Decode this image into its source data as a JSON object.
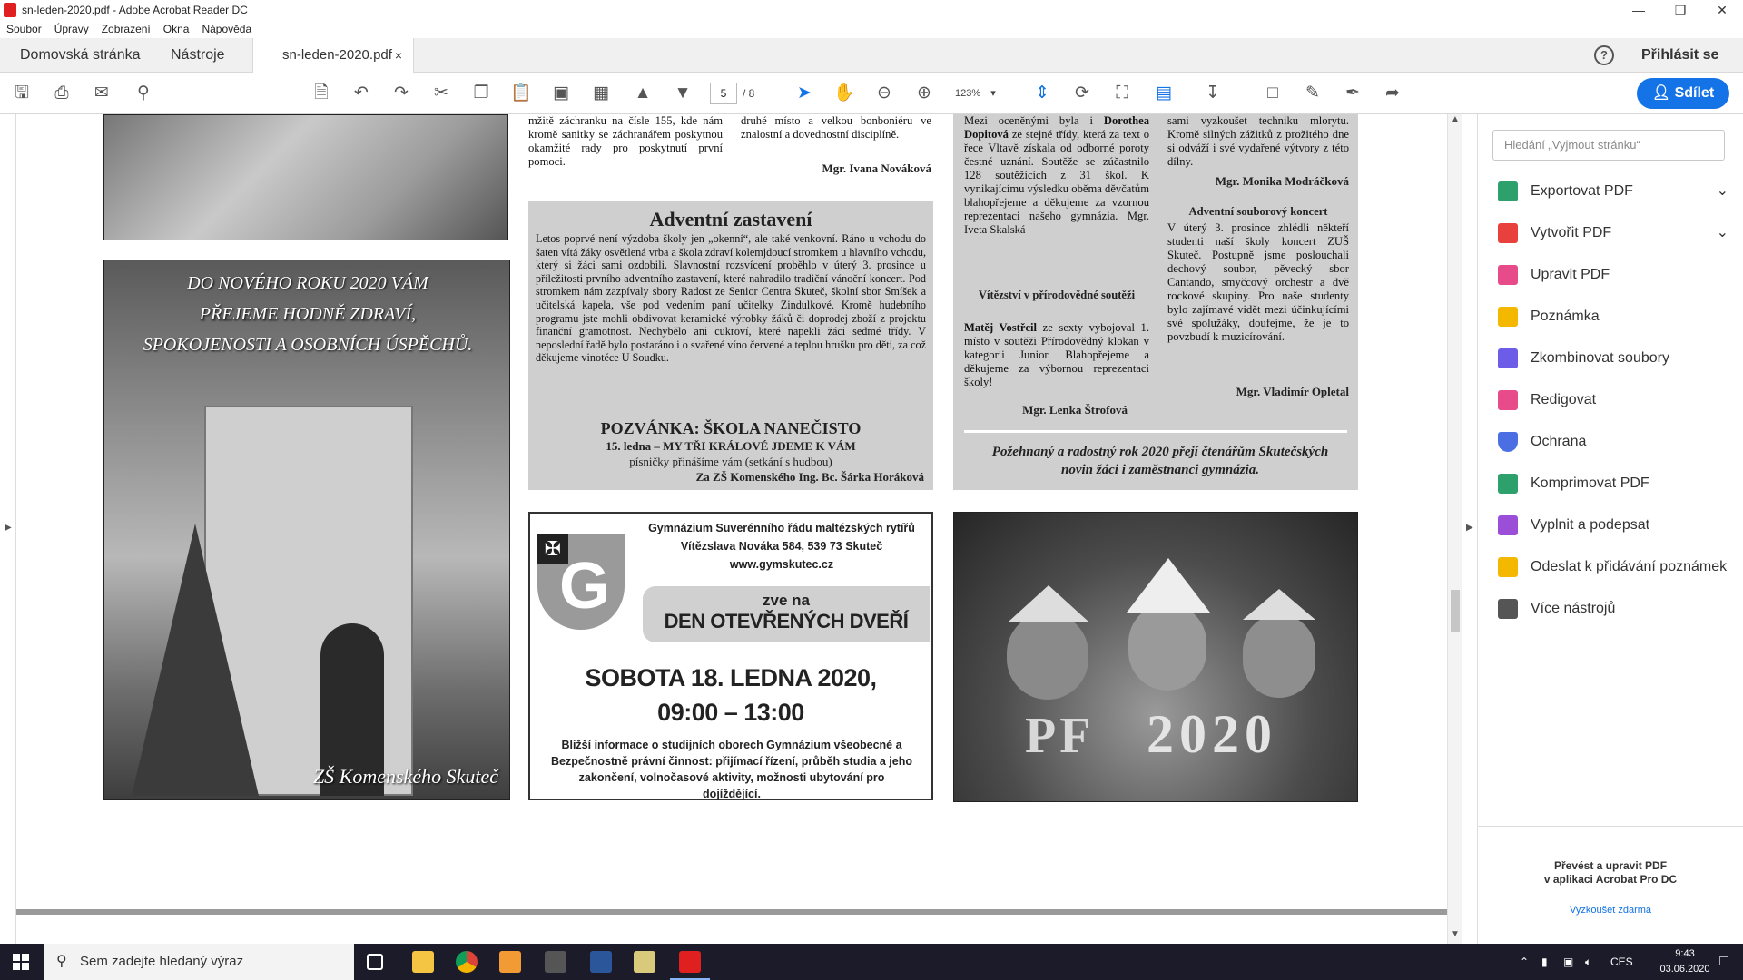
{
  "window": {
    "title": "sn-leden-2020.pdf - Adobe Acrobat Reader DC",
    "menu": [
      "Soubor",
      "Úpravy",
      "Zobrazení",
      "Okna",
      "Nápověda"
    ]
  },
  "tabs": {
    "home": "Domovská stránka",
    "tools": "Nástroje",
    "document": "sn-leden-2020.pdf",
    "close": "×"
  },
  "header": {
    "help": "?",
    "sign_in": "Přihlásit se",
    "share": "Sdílet"
  },
  "toolbar": {
    "page_current": "5",
    "page_total": "/ 8",
    "zoom": "123%"
  },
  "document": {
    "col2_top": "mžitě záchranku na čísle 155, kde nám kromě sanitky se záchranářem poskytnou okamžité rady pro poskytnutí první pomoci.",
    "col3_top": "druhé místo a velkou bonboniéru ve znalostní a dovednostní disciplíně.",
    "col3_sign": "Mgr. Ivana Nováková",
    "col4_top_1": "Mezi oceněnými byla i ",
    "col4_top_name": "Dorothea Dopitová",
    "col4_top_2": " ze stejné třídy, která za text o řece Vltavě získala od odborné poroty čestné uznání. Soutěže se zúčastnilo 128 soutěžících z 31 škol. K vynikajícímu výsledku oběma děvčatům blahopřejeme a děkujeme za vzornou reprezentaci našeho gymnázia. Mgr. Iveta Skalská",
    "col4_head2": "Vítězství v přírodovědné soutěži",
    "col4_name2": "Matěj Vostřcil",
    "col4_text2": " ze sexty vybojoval 1. místo v soutěži Přírodovědný klokan v kategorii Junior. Blahopřejeme a děkujeme za výbornou reprezentaci školy!",
    "col4_sign": "Mgr. Lenka Štrofová",
    "col5_top": "sami vyzkoušet techniku mlorytu. Kromě silných zážitků z prožitého dne si odváží i své vydařené výtvory z této dílny.",
    "col5_sign1": "Mgr. Monika Modráčková",
    "col5_head": "Adventní souborový koncert",
    "col5_text": "V úterý 3. prosince zhlédli někteří studenti naší školy koncert ZUŠ Skuteč. Postupně jsme poslouchali dechový soubor, pěvecký sbor Cantando, smyčcový orchestr a dvě rockové skupiny. Pro naše studenty bylo zajímavé vidět mezi účinkujícími své spolužáky, doufejme, že je to povzbudí k muzicírování.",
    "col5_sign2": "Mgr. Vladimír Opletal",
    "wish": "Požehnaný a radostný rok 2020 přejí čtenářům Skutečských novin žáci i zaměstnanci gymnázia.",
    "advent": {
      "title": "Adventní zastavení",
      "text": "Letos poprvé není výzdoba školy jen „okenní“, ale také venkovní. Ráno u vchodu do šaten vítá žáky osvětlená vrba a škola zdraví kolemjdoucí stromkem u hlavního vchodu, který si žáci sami ozdobili. Slavnostní rozsvícení proběhlo v úterý 3. prosince u příležitosti prvního adventního zastavení, které nahradilo tradiční vánoční koncert. Pod stromkem nám zazpívaly sbory Radost ze Senior Centra Skuteč, školní sbor Smíšek a učitelská kapela, vše pod vedením paní učitelky Zindulkové. Kromě hudebního programu jste mohli obdivovat keramické výrobky žáků či doprodej zboží z projektu finanční gramotnost. Nechybělo ani cukroví, které napekli žáci sedmé třídy. V neposlední řadě bylo postaráno i o svařené víno červené a teplou hrušku pro děti, za což děkujeme vinotéce U Soudku.",
      "invite_title": "POZVÁNKA: ŠKOLA NANEČISTO",
      "invite_line1": "15. ledna – MY TŘI KRÁLOVÉ JDEME K VÁM",
      "invite_line2": "písničky přinášíme vám (setkání s hudbou)",
      "invite_sign": "Za ZŠ Komenského Ing. Bc. Šárka Horáková"
    },
    "photo_wish": {
      "line1": "DO NOVÉHO ROKU 2020 VÁM",
      "line2": "PŘEJEME HODNĚ ZDRAVÍ,",
      "line3": "SPOKOJENOSTI A OSOBNÍCH ÚSPĚCHŮ.",
      "signature": "ZŠ Komenského Skuteč"
    },
    "gym_ad": {
      "school": "Gymnázium Suverénního řádu maltézských rytířů",
      "address": "Vítězslava Nováka 584, 539 73 Skuteč",
      "web": "www.gymskutec.cz",
      "invites": "zve na",
      "event": "DEN OTEVŘENÝCH DVEŘÍ",
      "date": "SOBOTA 18. LEDNA 2020,",
      "time": "09:00 – 13:00",
      "info": "Bližší informace o studijních oborech Gymnázium všeobecné a Bezpečnostně právní činnost: přijímací řízení, průběh studia a jeho zakončení, volnočasové aktivity, možnosti ubytování pro dojíždějící."
    },
    "pf_letters": [
      "PF",
      "2020"
    ]
  },
  "right_panel": {
    "search_placeholder": "Hledání „Vyjmout stránku“",
    "tools": [
      {
        "label": "Exportovat PDF",
        "color": "#2da06b",
        "chevron": "⌄"
      },
      {
        "label": "Vytvořit PDF",
        "color": "#e8403c",
        "chevron": "⌄"
      },
      {
        "label": "Upravit PDF",
        "color": "#e84b8a"
      },
      {
        "label": "Poznámka",
        "color": "#f5b800"
      },
      {
        "label": "Zkombinovat soubory",
        "color": "#6c5ce7"
      },
      {
        "label": "Redigovat",
        "color": "#e84b8a"
      },
      {
        "label": "Ochrana",
        "color": "#4b6fe3"
      },
      {
        "label": "Komprimovat PDF",
        "color": "#2da06b"
      },
      {
        "label": "Vyplnit a podepsat",
        "color": "#9b4ed8"
      },
      {
        "label": "Odeslat k přidávání poznámek",
        "color": "#f5b800"
      },
      {
        "label": "Více nástrojů",
        "color": "#555555"
      }
    ],
    "promo_line1": "Převést a upravit PDF",
    "promo_line2": "v aplikaci Acrobat Pro DC",
    "promo_link": "Vyzkoušet zdarma"
  },
  "taskbar": {
    "search_placeholder": "Sem zadejte hledaný výraz",
    "lang": "CES",
    "time": "9:43",
    "date": "03.06.2020"
  }
}
